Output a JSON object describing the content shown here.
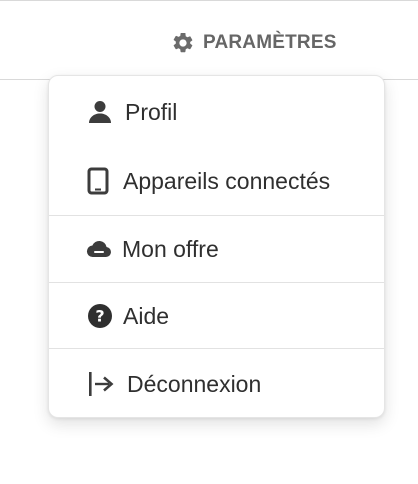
{
  "topbar": {
    "settings": {
      "icon": "gear-icon",
      "label": "PARAMÈTRES"
    }
  },
  "menu": {
    "items": [
      {
        "icon": "user-icon",
        "label": "Profil"
      },
      {
        "icon": "tablet-icon",
        "label": "Appareils connectés"
      },
      {
        "icon": "cloud-icon",
        "label": "Mon offre"
      },
      {
        "icon": "help-circle-icon",
        "label": "Aide"
      },
      {
        "icon": "logout-icon",
        "label": "Déconnexion"
      }
    ]
  },
  "colors": {
    "text": "#2f2f2f",
    "header_text": "#666666",
    "divider": "#e2e2e2"
  }
}
